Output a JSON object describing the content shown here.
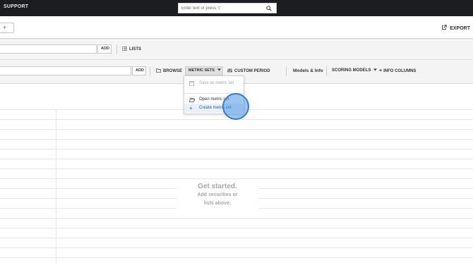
{
  "topbar": {
    "support_label": "SUPPORT",
    "search": {
      "placeholder": "Enter text or press \"/\""
    }
  },
  "header": {
    "add_tab_symbol": "+",
    "export_label": "EXPORT"
  },
  "toolbar": {
    "row1": {
      "add_label": "ADD",
      "lists_label": "LISTS"
    },
    "row2": {
      "add_label": "ADD",
      "browse_label": "BROWSE",
      "metric_sets_label": "METRIC SETS",
      "custom_period_label": "CUSTOM PERIOD",
      "models_info_label": "Models & Info",
      "scoring_models_label": "SCORING MODELS",
      "info_columns_label": "INFO COLUMNS"
    }
  },
  "metric_sets_menu": {
    "items": [
      {
        "label": "Save as metric set",
        "icon": "save-icon",
        "state": "disabled"
      },
      {
        "label": "Open metric set",
        "icon": "open-folder-icon",
        "state": "normal"
      },
      {
        "label": "Create metric set",
        "icon": "plus-icon",
        "state": "hover"
      }
    ]
  },
  "empty_state": {
    "title": "Get started.",
    "line1": "Add securities or",
    "line2": "lists above."
  },
  "colors": {
    "topbar_bg": "#1b1d21",
    "toolbar_bg": "#f4f4f4",
    "menu_active_bg": "#e8f0fa",
    "cursor_highlight": "#2f7fd1"
  }
}
